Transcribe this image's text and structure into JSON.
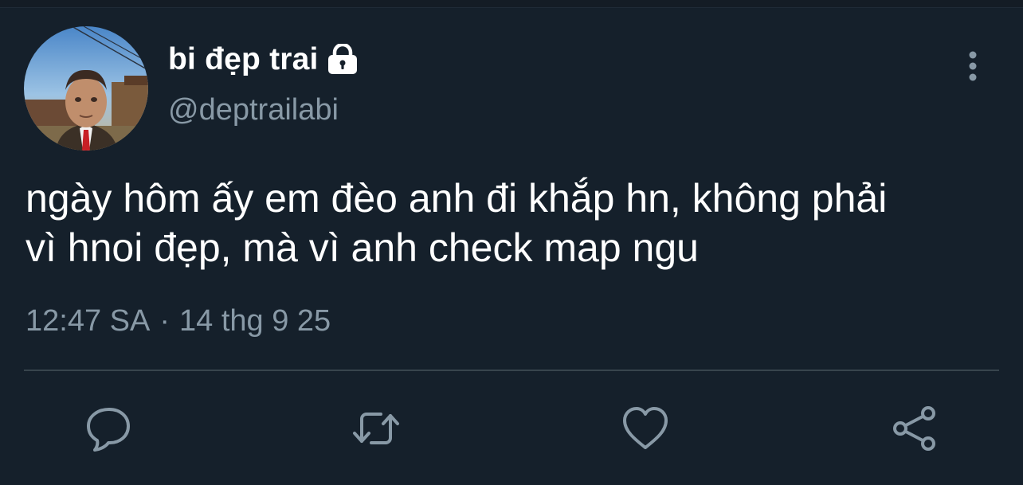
{
  "tweet": {
    "display_name": "bi đẹp trai",
    "handle": "@deptrailabi",
    "text_line1": "ngày hôm ấy em đèo anh đi khắp hn, không phải",
    "text_line2": "vì hnoi đẹp, mà vì anh check map ngu",
    "time": "12:47 SA",
    "separator": "·",
    "date": "14 thg 9 25"
  },
  "icons": {
    "lock": "lock-icon",
    "more": "more-vertical-icon",
    "reply": "comment-bubble-icon",
    "retweet": "retweet-icon",
    "like": "heart-icon",
    "share": "share-icon"
  },
  "colors": {
    "background": "#15202b",
    "primary_text": "#ffffff",
    "secondary_text": "#8899a6",
    "divider": "#38444d"
  }
}
